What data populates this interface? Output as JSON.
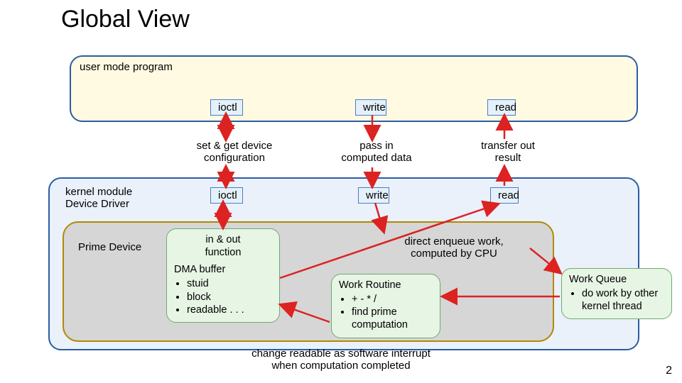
{
  "title": "Global View",
  "page_number": "2",
  "usermode_label": "user mode program",
  "kernel_label_l1": "kernel module",
  "kernel_label_l2": "Device Driver",
  "prime_label": "Prime Device",
  "ops": {
    "ioctl": "ioctl",
    "write": "write",
    "read": "read"
  },
  "mid": {
    "config_l1": "set & get device",
    "config_l2": "configuration",
    "pass_l1": "pass in",
    "pass_l2": "computed data",
    "xfer_l1": "transfer out",
    "xfer_l2": "result"
  },
  "inout": {
    "title_l1": "in & out",
    "title_l2": "function",
    "sub": "DMA buffer",
    "b1": "stuid",
    "b2": "block",
    "b3": "readable . . ."
  },
  "routine": {
    "title": "Work Routine",
    "b1": "+ - * /",
    "b2_l1": "find prime",
    "b2_l2": "computation"
  },
  "enqueue_l1": "direct enqueue work,",
  "enqueue_l2": "computed by CPU",
  "workq": {
    "title": "Work Queue",
    "b1_l1": "do work by other",
    "b1_l2": "kernel thread"
  },
  "interrupt_l1": "change readable as software interrupt",
  "interrupt_l2": "when computation completed"
}
